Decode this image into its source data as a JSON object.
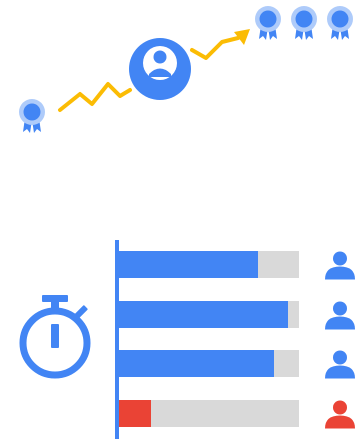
{
  "colors": {
    "blue": "#4285f4",
    "light_blue": "#aecbfa",
    "yellow": "#fbbc04",
    "red": "#ea4335",
    "track": "#d9d9d9",
    "white": "#ffffff"
  },
  "icons": {
    "start_badge": "award-ribbon-icon",
    "progress_arrow": "trend-arrow-icon",
    "avatar": "user-avatar-icon",
    "badges": [
      "award-ribbon-icon",
      "award-ribbon-icon",
      "award-ribbon-icon"
    ],
    "timer": "stopwatch-icon",
    "person": "person-icon"
  },
  "rows": [
    {
      "fill": 0.77,
      "status": "normal"
    },
    {
      "fill": 0.94,
      "status": "normal"
    },
    {
      "fill": 0.86,
      "status": "normal"
    },
    {
      "fill": 0.18,
      "status": "alert"
    }
  ]
}
